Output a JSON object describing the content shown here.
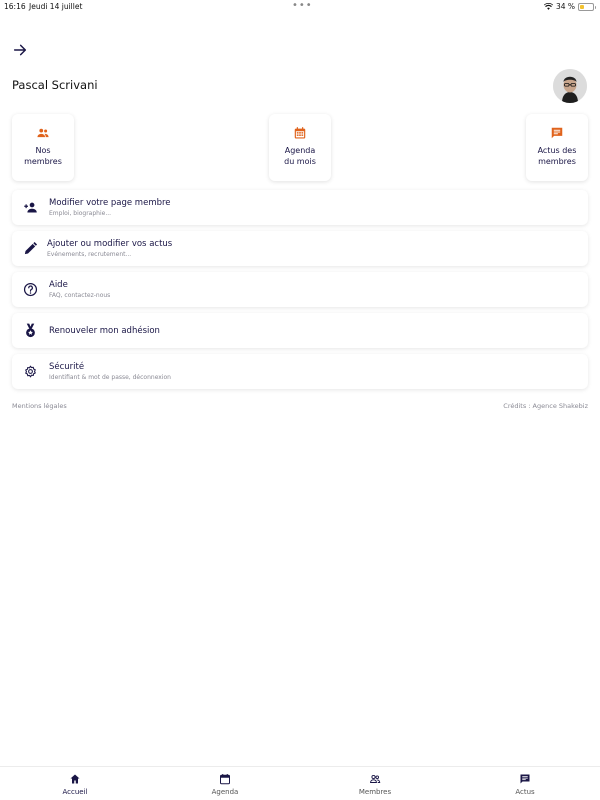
{
  "status_bar": {
    "time": "16:16",
    "date": "Jeudi 14 juillet",
    "battery": "34 %",
    "battery_level": 0.34
  },
  "header": {
    "user_name": "Pascal Scrivani"
  },
  "colors": {
    "accent_orange": "#e0631c",
    "navy": "#1a1646",
    "muted": "#8a8a94"
  },
  "tiles": [
    {
      "label": "Nos\nmembres",
      "icon": "group-icon"
    },
    {
      "label": "Agenda\ndu mois",
      "icon": "calendar-icon"
    },
    {
      "label": "Actus des\nmembres",
      "icon": "chat-icon"
    }
  ],
  "menu": [
    {
      "title": "Modifier votre page membre",
      "subtitle": "Emploi, biographie...",
      "icon": "person-add-icon"
    },
    {
      "title": "Ajouter ou modifier vos actus",
      "subtitle": "Evénements, recrutement...",
      "icon": "pencil-icon"
    },
    {
      "title": "Aide",
      "subtitle": "FAQ, contactez-nous",
      "icon": "help-circle-icon"
    },
    {
      "title": "Renouveler mon adhésion",
      "subtitle": "",
      "icon": "medal-icon"
    },
    {
      "title": "Sécurité",
      "subtitle": "Identifiant & mot de passe, déconnexion",
      "icon": "gear-icon"
    }
  ],
  "footer": {
    "legal": "Mentions légales",
    "credits": "Crédits : Agence Shakebiz"
  },
  "tabbar": [
    {
      "label": "Accueil",
      "icon": "home-icon",
      "active": true
    },
    {
      "label": "Agenda",
      "icon": "calendar-icon",
      "active": false
    },
    {
      "label": "Membres",
      "icon": "group-icon",
      "active": false
    },
    {
      "label": "Actus",
      "icon": "chat-icon",
      "active": false
    }
  ]
}
